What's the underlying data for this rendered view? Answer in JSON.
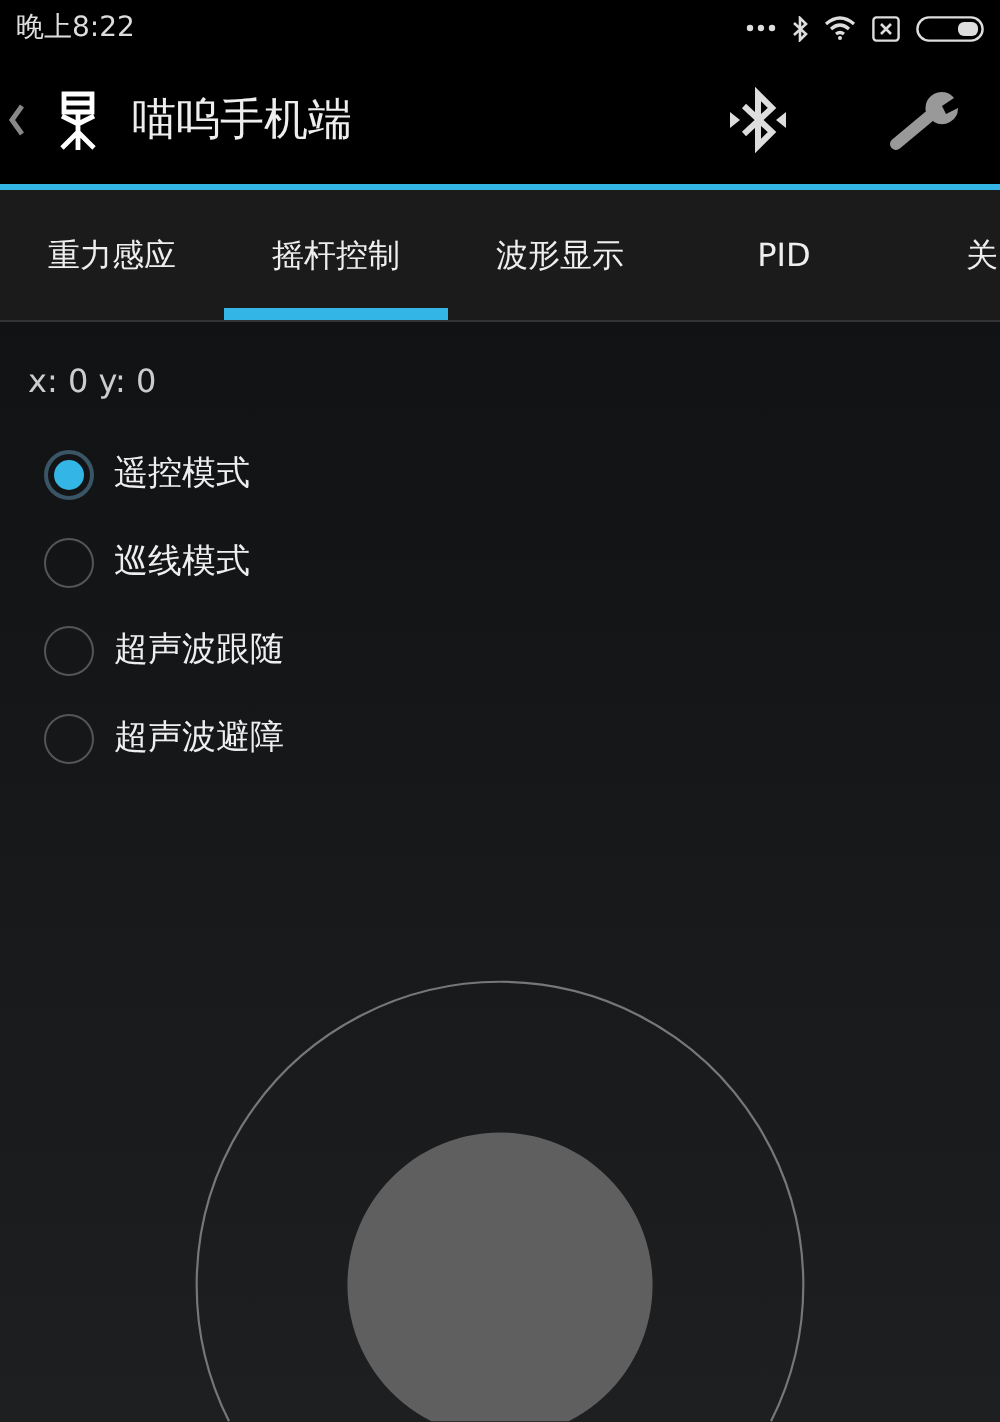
{
  "status_bar": {
    "time": "晚上8:22"
  },
  "action_bar": {
    "title": "喵呜手机端"
  },
  "tabs": [
    {
      "label": "重力感应",
      "selected": false
    },
    {
      "label": "摇杆控制",
      "selected": true
    },
    {
      "label": "波形显示",
      "selected": false
    },
    {
      "label": "PID",
      "selected": false
    },
    {
      "label": "关",
      "selected": false
    }
  ],
  "coordinates": "x: 0 y: 0",
  "modes": [
    {
      "label": "遥控模式",
      "selected": true
    },
    {
      "label": "巡线模式",
      "selected": false
    },
    {
      "label": "超声波跟随",
      "selected": false
    },
    {
      "label": "超声波避障",
      "selected": false
    }
  ]
}
